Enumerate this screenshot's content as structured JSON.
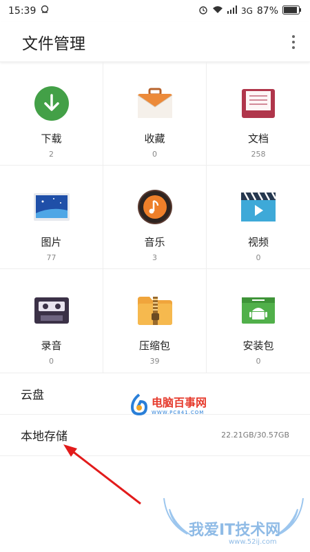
{
  "status": {
    "time": "15:39",
    "network": "3G",
    "battery": "87%"
  },
  "header": {
    "title": "文件管理"
  },
  "categories": [
    {
      "label": "下载",
      "count": "2",
      "icon": "download-icon"
    },
    {
      "label": "收藏",
      "count": "0",
      "icon": "briefcase-icon"
    },
    {
      "label": "文档",
      "count": "258",
      "icon": "document-icon"
    },
    {
      "label": "图片",
      "count": "77",
      "icon": "image-icon"
    },
    {
      "label": "音乐",
      "count": "3",
      "icon": "music-icon"
    },
    {
      "label": "视频",
      "count": "0",
      "icon": "video-icon"
    },
    {
      "label": "录音",
      "count": "0",
      "icon": "cassette-icon"
    },
    {
      "label": "压缩包",
      "count": "39",
      "icon": "zip-icon"
    },
    {
      "label": "安装包",
      "count": "0",
      "icon": "android-icon"
    }
  ],
  "storage": [
    {
      "label": "云盘",
      "value": ""
    },
    {
      "label": "本地存储",
      "value": "22.21GB/30.57GB"
    }
  ],
  "watermarks": {
    "site1": "电脑百事网",
    "site1_url": "WWW.PC841.COM",
    "site2": "我爱IT技术网",
    "site2_url": "www.52ij.com"
  },
  "colors": {
    "annotation_arrow": "#e21b1b"
  }
}
